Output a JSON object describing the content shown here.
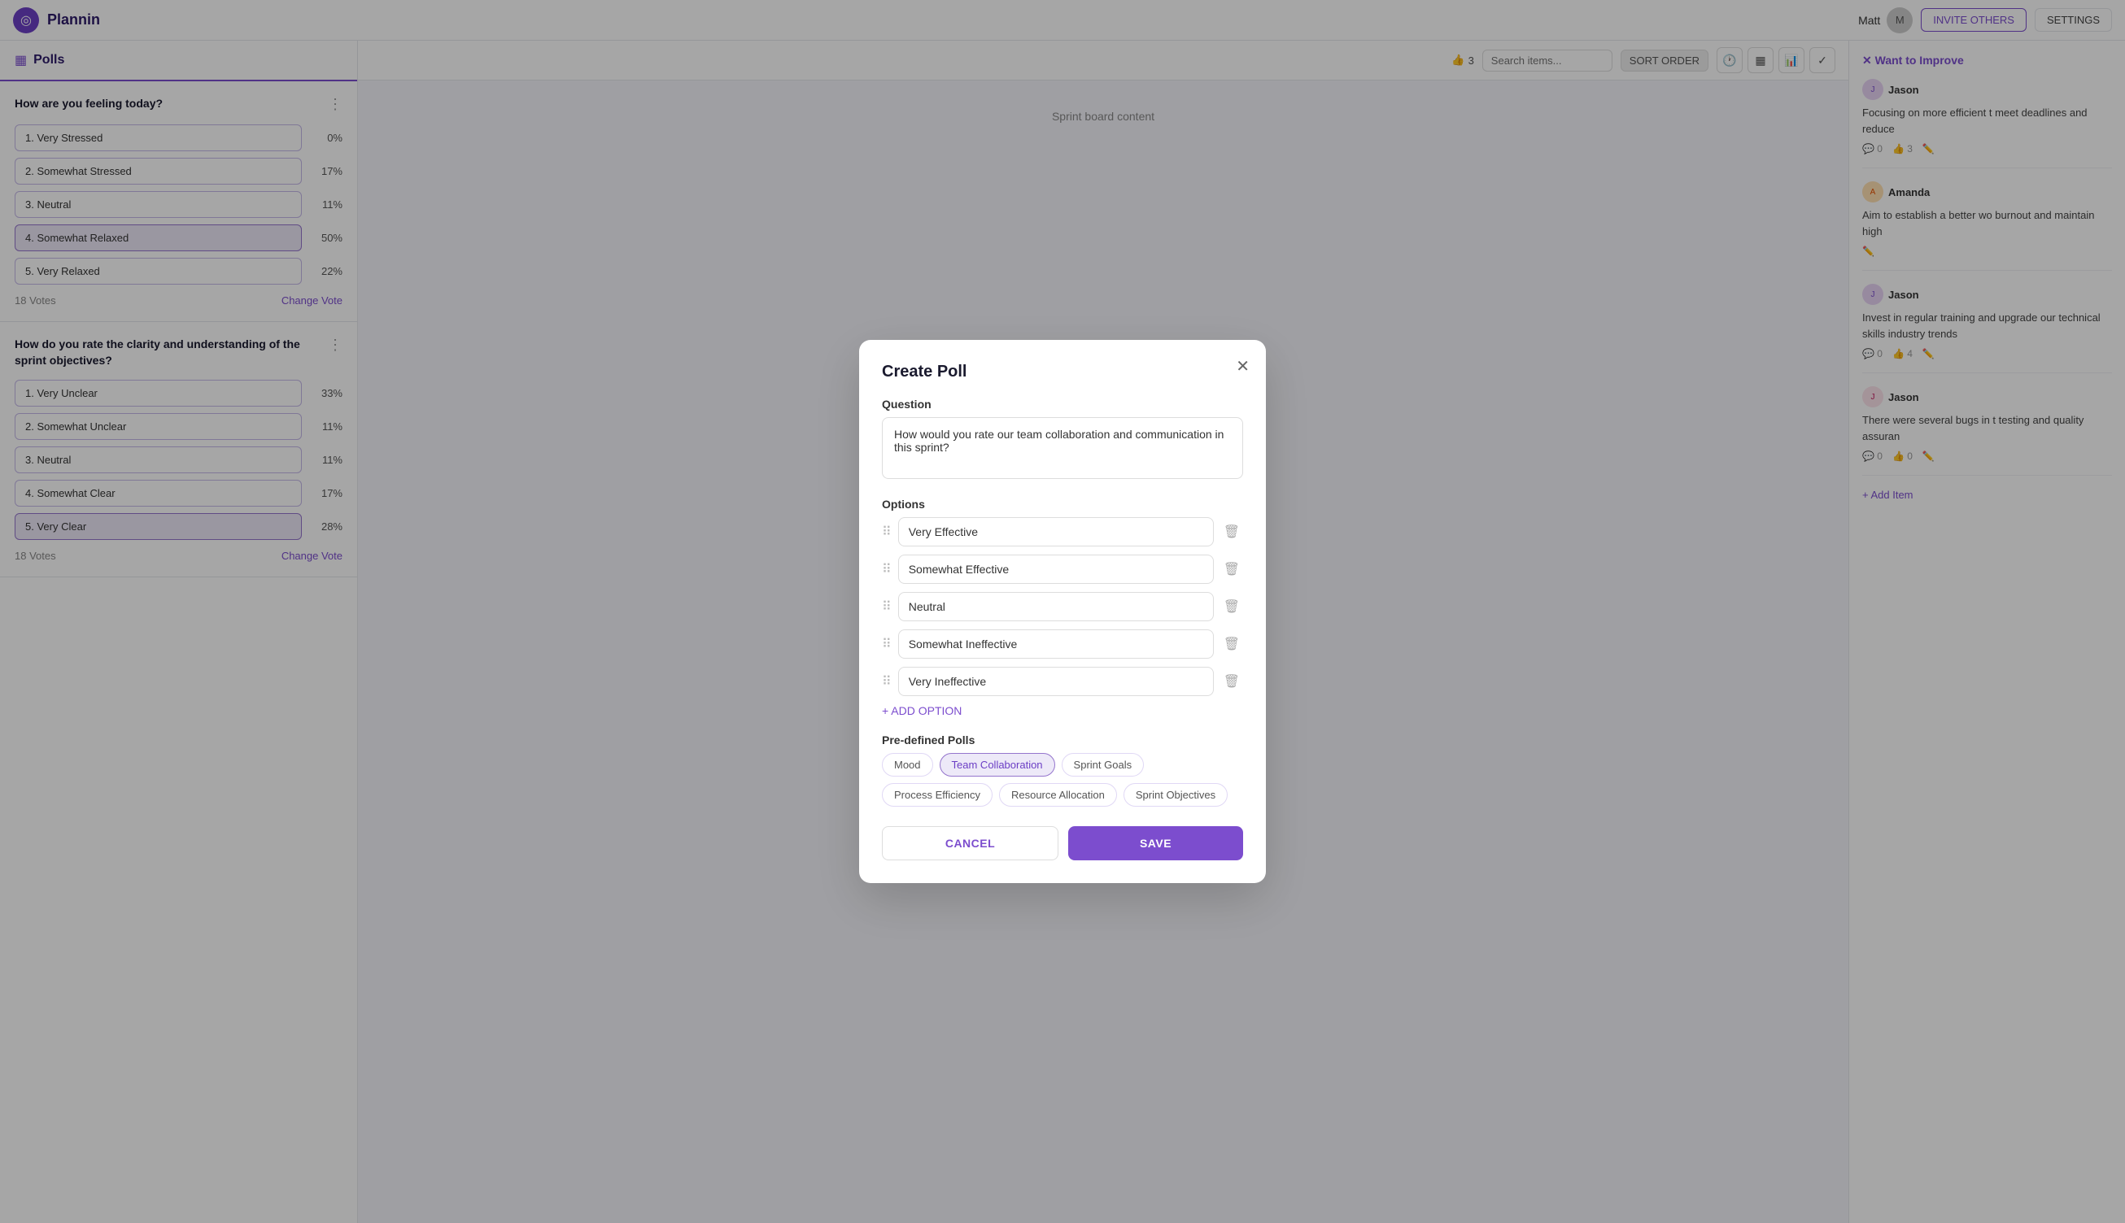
{
  "app": {
    "name": "Plannin",
    "logo": "◎"
  },
  "nav": {
    "user": "Matt",
    "invite_label": "INVITE OTHERS",
    "settings_label": "SETTINGS"
  },
  "polls": {
    "title": "Polls",
    "poll1": {
      "question": "How are you feeling today?",
      "options": [
        {
          "label": "1. Very Stressed",
          "pct": "0%",
          "selected": false
        },
        {
          "label": "2. Somewhat Stressed",
          "pct": "17%",
          "selected": false
        },
        {
          "label": "3. Neutral",
          "pct": "11%",
          "selected": false
        },
        {
          "label": "4. Somewhat Relaxed",
          "pct": "50%",
          "selected": true
        },
        {
          "label": "5. Very Relaxed",
          "pct": "22%",
          "selected": false
        }
      ],
      "votes": "18 Votes",
      "change_vote": "Change Vote"
    },
    "poll2": {
      "question": "How do you rate the clarity and understanding of the sprint objectives?",
      "options": [
        {
          "label": "1. Very Unclear",
          "pct": "33%",
          "selected": false
        },
        {
          "label": "2. Somewhat Unclear",
          "pct": "11%",
          "selected": false
        },
        {
          "label": "3. Neutral",
          "pct": "11%",
          "selected": false
        },
        {
          "label": "4. Somewhat Clear",
          "pct": "17%",
          "selected": false
        },
        {
          "label": "5. Very Clear",
          "pct": "28%",
          "selected": true
        }
      ],
      "votes": "18 Votes",
      "change_vote": "Change Vote"
    }
  },
  "toolbar": {
    "search_placeholder": "Search items...",
    "sort_label": "SORT ORDER",
    "like_count": "3"
  },
  "right_panel": {
    "section_title": "✕ Want to Improve",
    "items": [
      {
        "user": "Jason",
        "avatar_color": "purple",
        "text": "Focusing on more efficient t meet deadlines and reduce",
        "comments": "0",
        "likes": "3"
      },
      {
        "user": "Amanda",
        "avatar_color": "orange",
        "text": "Aim to establish a better wo burnout and maintain high",
        "comments": "",
        "likes": ""
      },
      {
        "user": "Jason",
        "avatar_color": "purple",
        "text": "Invest in regular training and upgrade our technical skills industry trends",
        "comments": "0",
        "likes": "4"
      },
      {
        "user": "Jason",
        "avatar_color": "pink",
        "text": "There were several bugs in t testing and quality assuran",
        "comments": "0",
        "likes": "0"
      }
    ],
    "add_item": "+ Add Item"
  },
  "modal": {
    "title": "Create Poll",
    "question_label": "Question",
    "question_value": "How would you rate our team collaboration and communication in this sprint?",
    "options_label": "Options",
    "options": [
      "Very Effective",
      "Somewhat Effective",
      "Neutral",
      "Somewhat Ineffective",
      "Very Ineffective"
    ],
    "add_option": "+ ADD OPTION",
    "predefined_label": "Pre-defined Polls",
    "predefined_tags": [
      {
        "label": "Mood",
        "active": false
      },
      {
        "label": "Team Collaboration",
        "active": true
      },
      {
        "label": "Sprint Goals",
        "active": false
      },
      {
        "label": "Process Efficiency",
        "active": false
      },
      {
        "label": "Resource Allocation",
        "active": false
      },
      {
        "label": "Sprint Objectives",
        "active": false
      }
    ],
    "cancel_label": "CANCEL",
    "save_label": "SAVE"
  }
}
